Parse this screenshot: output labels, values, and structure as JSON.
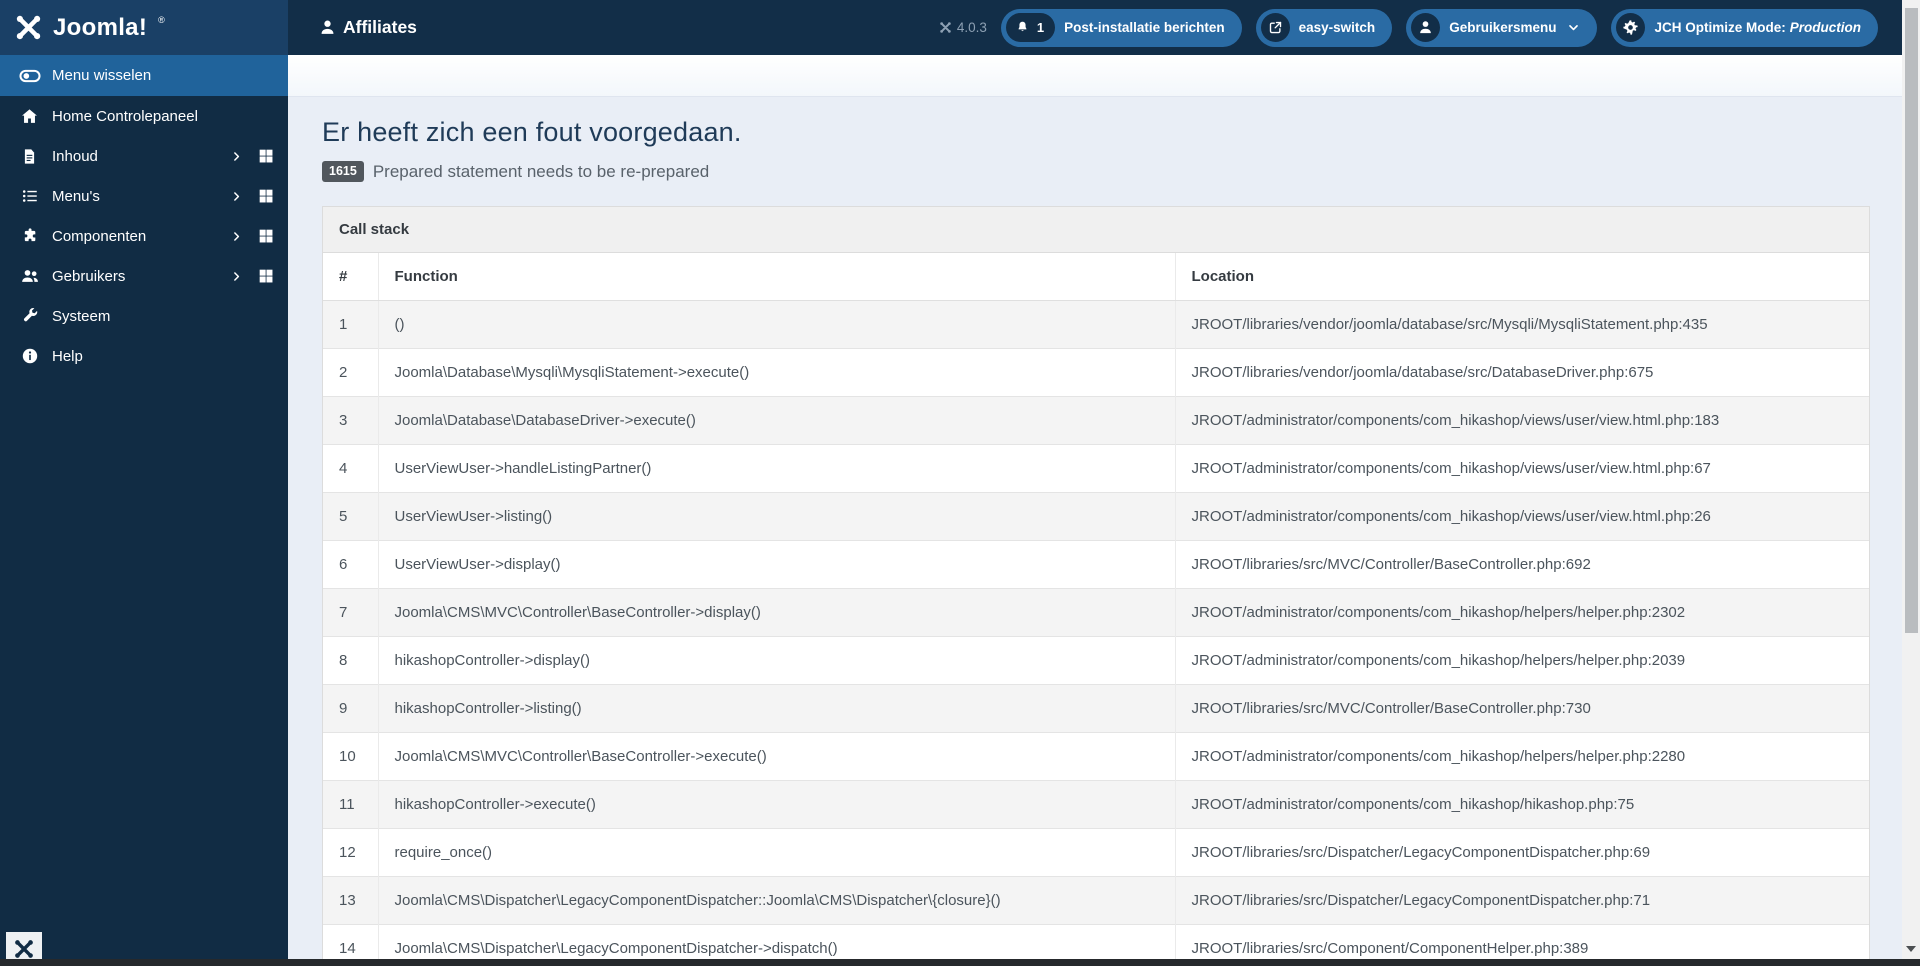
{
  "sidebar": {
    "logo_text": "Joomla!",
    "logo_reg": "®",
    "items": [
      {
        "label": "Menu wisselen"
      },
      {
        "label": "Home Controlepaneel"
      },
      {
        "label": "Inhoud"
      },
      {
        "label": "Menu's"
      },
      {
        "label": "Componenten"
      },
      {
        "label": "Gebruikers"
      },
      {
        "label": "Systeem"
      },
      {
        "label": "Help"
      }
    ]
  },
  "header": {
    "title": "Affiliates",
    "version": "4.0.3",
    "buttons": [
      {
        "label": "Post-installatie berichten",
        "badge": "1"
      },
      {
        "label": "easy-switch"
      },
      {
        "label": "Gebruikersmenu"
      },
      {
        "label_prefix": "JCH Optimize Mode:",
        "label_value": "Production"
      }
    ]
  },
  "error": {
    "heading": "Er heeft zich een fout voorgedaan.",
    "code": "1615",
    "message": "Prepared statement needs to be re-prepared"
  },
  "callstack": {
    "panel_title": "Call stack",
    "columns": [
      "#",
      "Function",
      "Location"
    ],
    "rows": [
      [
        "1",
        "()",
        "JROOT/libraries/vendor/joomla/database/src/Mysqli/MysqliStatement.php:435"
      ],
      [
        "2",
        "Joomla\\Database\\Mysqli\\MysqliStatement->execute()",
        "JROOT/libraries/vendor/joomla/database/src/DatabaseDriver.php:675"
      ],
      [
        "3",
        "Joomla\\Database\\DatabaseDriver->execute()",
        "JROOT/administrator/components/com_hikashop/views/user/view.html.php:183"
      ],
      [
        "4",
        "UserViewUser->handleListingPartner()",
        "JROOT/administrator/components/com_hikashop/views/user/view.html.php:67"
      ],
      [
        "5",
        "UserViewUser->listing()",
        "JROOT/administrator/components/com_hikashop/views/user/view.html.php:26"
      ],
      [
        "6",
        "UserViewUser->display()",
        "JROOT/libraries/src/MVC/Controller/BaseController.php:692"
      ],
      [
        "7",
        "Joomla\\CMS\\MVC\\Controller\\BaseController->display()",
        "JROOT/administrator/components/com_hikashop/helpers/helper.php:2302"
      ],
      [
        "8",
        "hikashopController->display()",
        "JROOT/administrator/components/com_hikashop/helpers/helper.php:2039"
      ],
      [
        "9",
        "hikashopController->listing()",
        "JROOT/libraries/src/MVC/Controller/BaseController.php:730"
      ],
      [
        "10",
        "Joomla\\CMS\\MVC\\Controller\\BaseController->execute()",
        "JROOT/administrator/components/com_hikashop/helpers/helper.php:2280"
      ],
      [
        "11",
        "hikashopController->execute()",
        "JROOT/administrator/components/com_hikashop/hikashop.php:75"
      ],
      [
        "12",
        "require_once()",
        "JROOT/libraries/src/Dispatcher/LegacyComponentDispatcher.php:69"
      ],
      [
        "13",
        "Joomla\\CMS\\Dispatcher\\LegacyComponentDispatcher::Joomla\\CMS\\Dispatcher\\{closure}()",
        "JROOT/libraries/src/Dispatcher/LegacyComponentDispatcher.php:71"
      ],
      [
        "14",
        "Joomla\\CMS\\Dispatcher\\LegacyComponentDispatcher->dispatch()",
        "JROOT/libraries/src/Component/ComponentHelper.php:389"
      ]
    ]
  },
  "colors": {
    "header_bg": "#122e48",
    "sidebar_bg": "#112c44",
    "sidebar_logo_bg": "#1a4066",
    "active_item_bg": "#20639b",
    "pill_bg": "#2a6ba4",
    "content_bg": "#e9eef6",
    "stripe_bg": "#f4f4f4"
  }
}
